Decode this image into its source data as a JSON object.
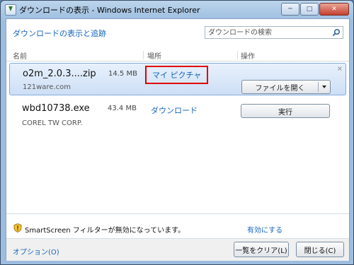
{
  "window": {
    "title": "ダウンロードの表示 - Windows Internet Explorer",
    "buttons": {
      "minimize": "─",
      "maximize": "□",
      "close": "✕"
    }
  },
  "header": {
    "link": "ダウンロードの表示と追跡",
    "search_placeholder": "ダウンロードの検索"
  },
  "columns": {
    "name": "名前",
    "location": "場所",
    "actions": "操作"
  },
  "downloads": [
    {
      "file_name": "o2m_2.0.3....zip",
      "size": "14.5 MB",
      "source": "121ware.com",
      "location": "マイ ピクチャ",
      "action_label": "ファイルを開く",
      "dismiss": "×"
    },
    {
      "file_name": "wbd10738.exe",
      "size": "43.4 MB",
      "source": "COREL TW CORP.",
      "location": "ダウンロード",
      "action_label": "実行"
    }
  ],
  "smartscreen": {
    "text": "SmartScreen フィルターが無効になっています。",
    "enable_link": "有効にする"
  },
  "footer": {
    "options_label": "オプション(O)",
    "clear_label": "一覧をクリア(L)",
    "close_label": "閉じる(C)"
  },
  "colors": {
    "link": "#1664b9",
    "highlight_box": "#e00000",
    "selection": "#cddff6"
  }
}
